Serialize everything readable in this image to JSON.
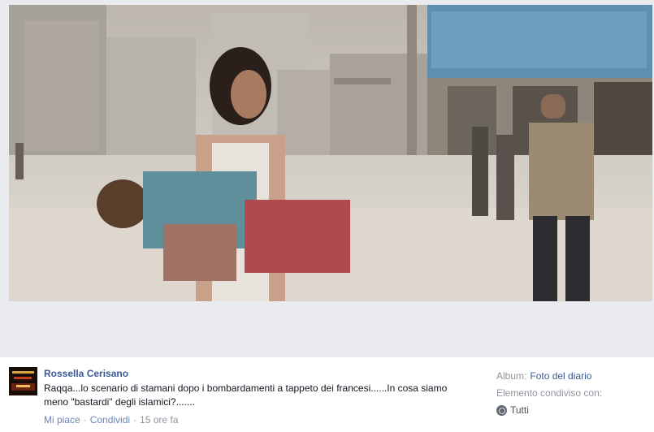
{
  "photo": {
    "alt_icon": "news-photo"
  },
  "post": {
    "author": "Rossella Cerisano",
    "text": "Raqqa...lo scenario di stamani dopo i bombardamenti a tappeto dei francesi......In cosa siamo meno \"bastardi\" degli islamici?.......",
    "like_label": "Mi piace",
    "share_label": "Condividi",
    "timestamp": "15 ore fa"
  },
  "meta": {
    "album_label": "Album:",
    "album_link": "Foto del diario",
    "shared_label": "Elemento condiviso con:",
    "audience": "Tutti"
  }
}
